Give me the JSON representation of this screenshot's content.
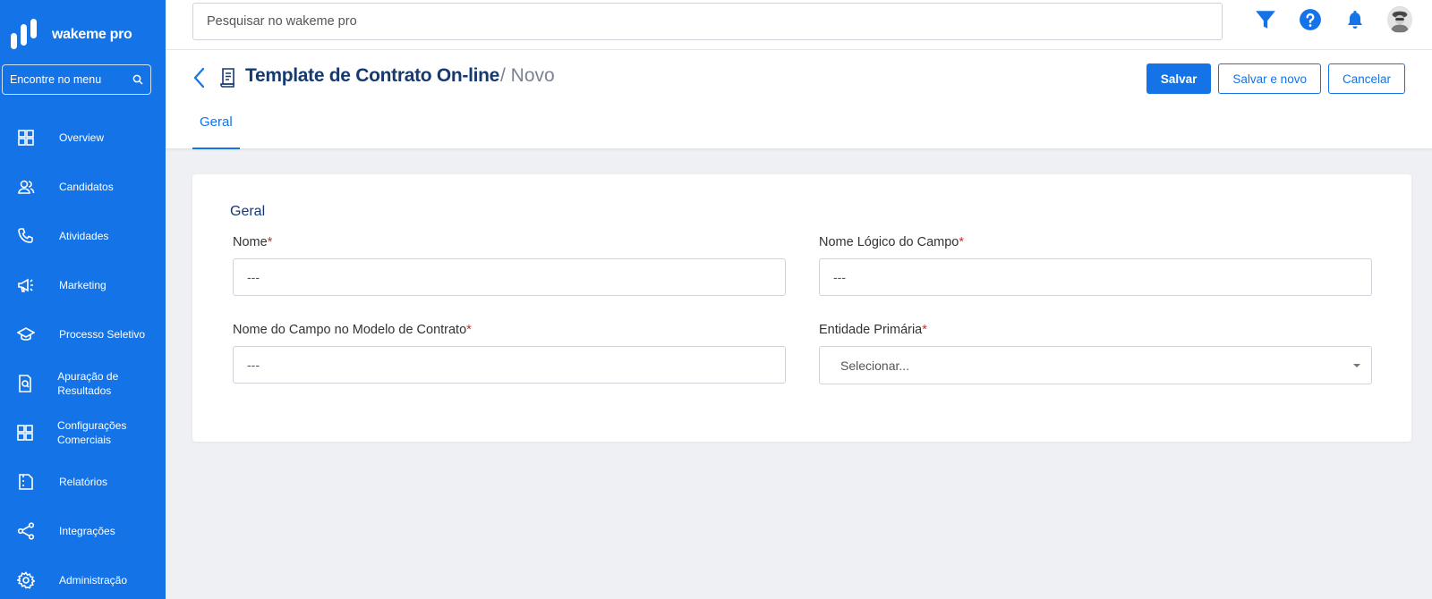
{
  "brand": {
    "name": "wakeme",
    "suffix": " pro"
  },
  "menu_search": {
    "placeholder": "Encontre no menu"
  },
  "sidebar": {
    "items": [
      {
        "label": "Overview",
        "icon": "grid-icon"
      },
      {
        "label": "Candidatos",
        "icon": "users-icon"
      },
      {
        "label": "Atividades",
        "icon": "phone-icon"
      },
      {
        "label": "Marketing",
        "icon": "megaphone-icon"
      },
      {
        "label": "Processo Seletivo",
        "icon": "graduation-cap-icon"
      },
      {
        "label": "Apuração de Resultados",
        "icon": "document-search-icon"
      },
      {
        "label": "Configurações Comerciais",
        "icon": "grid-icon"
      },
      {
        "label": "Relatórios",
        "icon": "report-icon"
      },
      {
        "label": "Integrações",
        "icon": "share-icon"
      },
      {
        "label": "Administração",
        "icon": "gear-icon"
      }
    ]
  },
  "topbar": {
    "search_placeholder": "Pesquisar no wakeme pro",
    "icons": [
      "filter-icon",
      "help-icon",
      "bell-icon",
      "avatar"
    ]
  },
  "header": {
    "title": "Template de Contrato On-line",
    "subtitle": "/ Novo",
    "actions": {
      "save": "Salvar",
      "save_new": "Salvar e novo",
      "cancel": "Cancelar"
    },
    "tabs": [
      {
        "label": "Geral",
        "active": true
      }
    ]
  },
  "form": {
    "section_title": "Geral",
    "required_mark": "*",
    "fields": {
      "nome": {
        "label": "Nome",
        "value": "---"
      },
      "nome_logico": {
        "label": "Nome Lógico do Campo",
        "value": "---"
      },
      "nome_campo_modelo": {
        "label": "Nome do Campo no Modelo de Contrato",
        "value": "---"
      },
      "entidade_primaria": {
        "label": "Entidade Primária",
        "value": "Selecionar..."
      }
    }
  },
  "colors": {
    "primary": "#1473e6",
    "title": "#173a6e",
    "required": "#e0262b",
    "background": "#eef0f3"
  }
}
